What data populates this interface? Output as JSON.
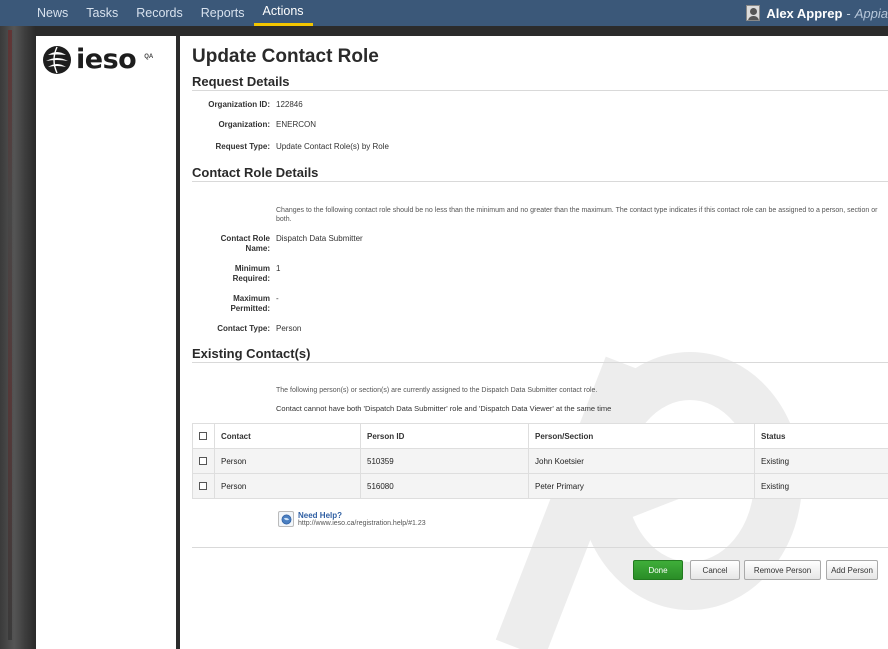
{
  "nav": {
    "items": [
      "News",
      "Tasks",
      "Records",
      "Reports",
      "Actions"
    ],
    "active_index": 4
  },
  "user": {
    "name": "Alex Apprep",
    "separator": "-",
    "app": "Appia"
  },
  "logo": {
    "text": "ieso",
    "badge": "QA"
  },
  "page": {
    "title": "Update Contact Role"
  },
  "request_details": {
    "heading": "Request Details",
    "fields": [
      {
        "label": "Organization ID:",
        "value": "122846"
      },
      {
        "label": "Organization:",
        "value": "ENERCON"
      },
      {
        "label": "Request Type:",
        "value": "Update Contact Role(s) by Role"
      }
    ]
  },
  "contact_role_details": {
    "heading": "Contact Role Details",
    "help": "Changes to the following contact role should be no less than the minimum and no greater than the maximum. The contact type indicates if this contact role can be assigned to a person, section or both.",
    "fields": [
      {
        "label_line1": "Contact Role",
        "label_line2": "Name:",
        "value": "Dispatch Data Submitter"
      },
      {
        "label_line1": "Minimum",
        "label_line2": "Required:",
        "value": "1"
      },
      {
        "label_line1": "Maximum",
        "label_line2": "Permitted:",
        "value": "-"
      }
    ],
    "contact_type": {
      "label": "Contact Type:",
      "value": "Person"
    }
  },
  "existing_contacts": {
    "heading": "Existing Contact(s)",
    "help": "The following person(s) or section(s) are currently assigned to the Dispatch Data Submitter contact role.",
    "warning": "Contact cannot have both 'Dispatch Data Submitter' role and 'Dispatch Data Viewer' at the same time",
    "columns": [
      "Contact",
      "Person ID",
      "Person/Section",
      "Status"
    ],
    "rows": [
      {
        "contact": "Person",
        "person_id": "510359",
        "person_section": "John Koetsier",
        "status": "Existing"
      },
      {
        "contact": "Person",
        "person_id": "516080",
        "person_section": "Peter Primary",
        "status": "Existing"
      }
    ]
  },
  "help_link": {
    "title": "Need Help?",
    "url": "http://www.ieso.ca/registration.help/#1.23"
  },
  "buttons": {
    "done": "Done",
    "cancel": "Cancel",
    "remove": "Remove Person",
    "add": "Add Person"
  },
  "colors": {
    "nav_bg": "#3b5879",
    "nav_active": "#f2c500",
    "primary_button": "#2f9b2c",
    "link": "#2f5fa3"
  },
  "icons": [
    "user-avatar-icon",
    "ieso-logo-icon",
    "help-globe-icon"
  ]
}
